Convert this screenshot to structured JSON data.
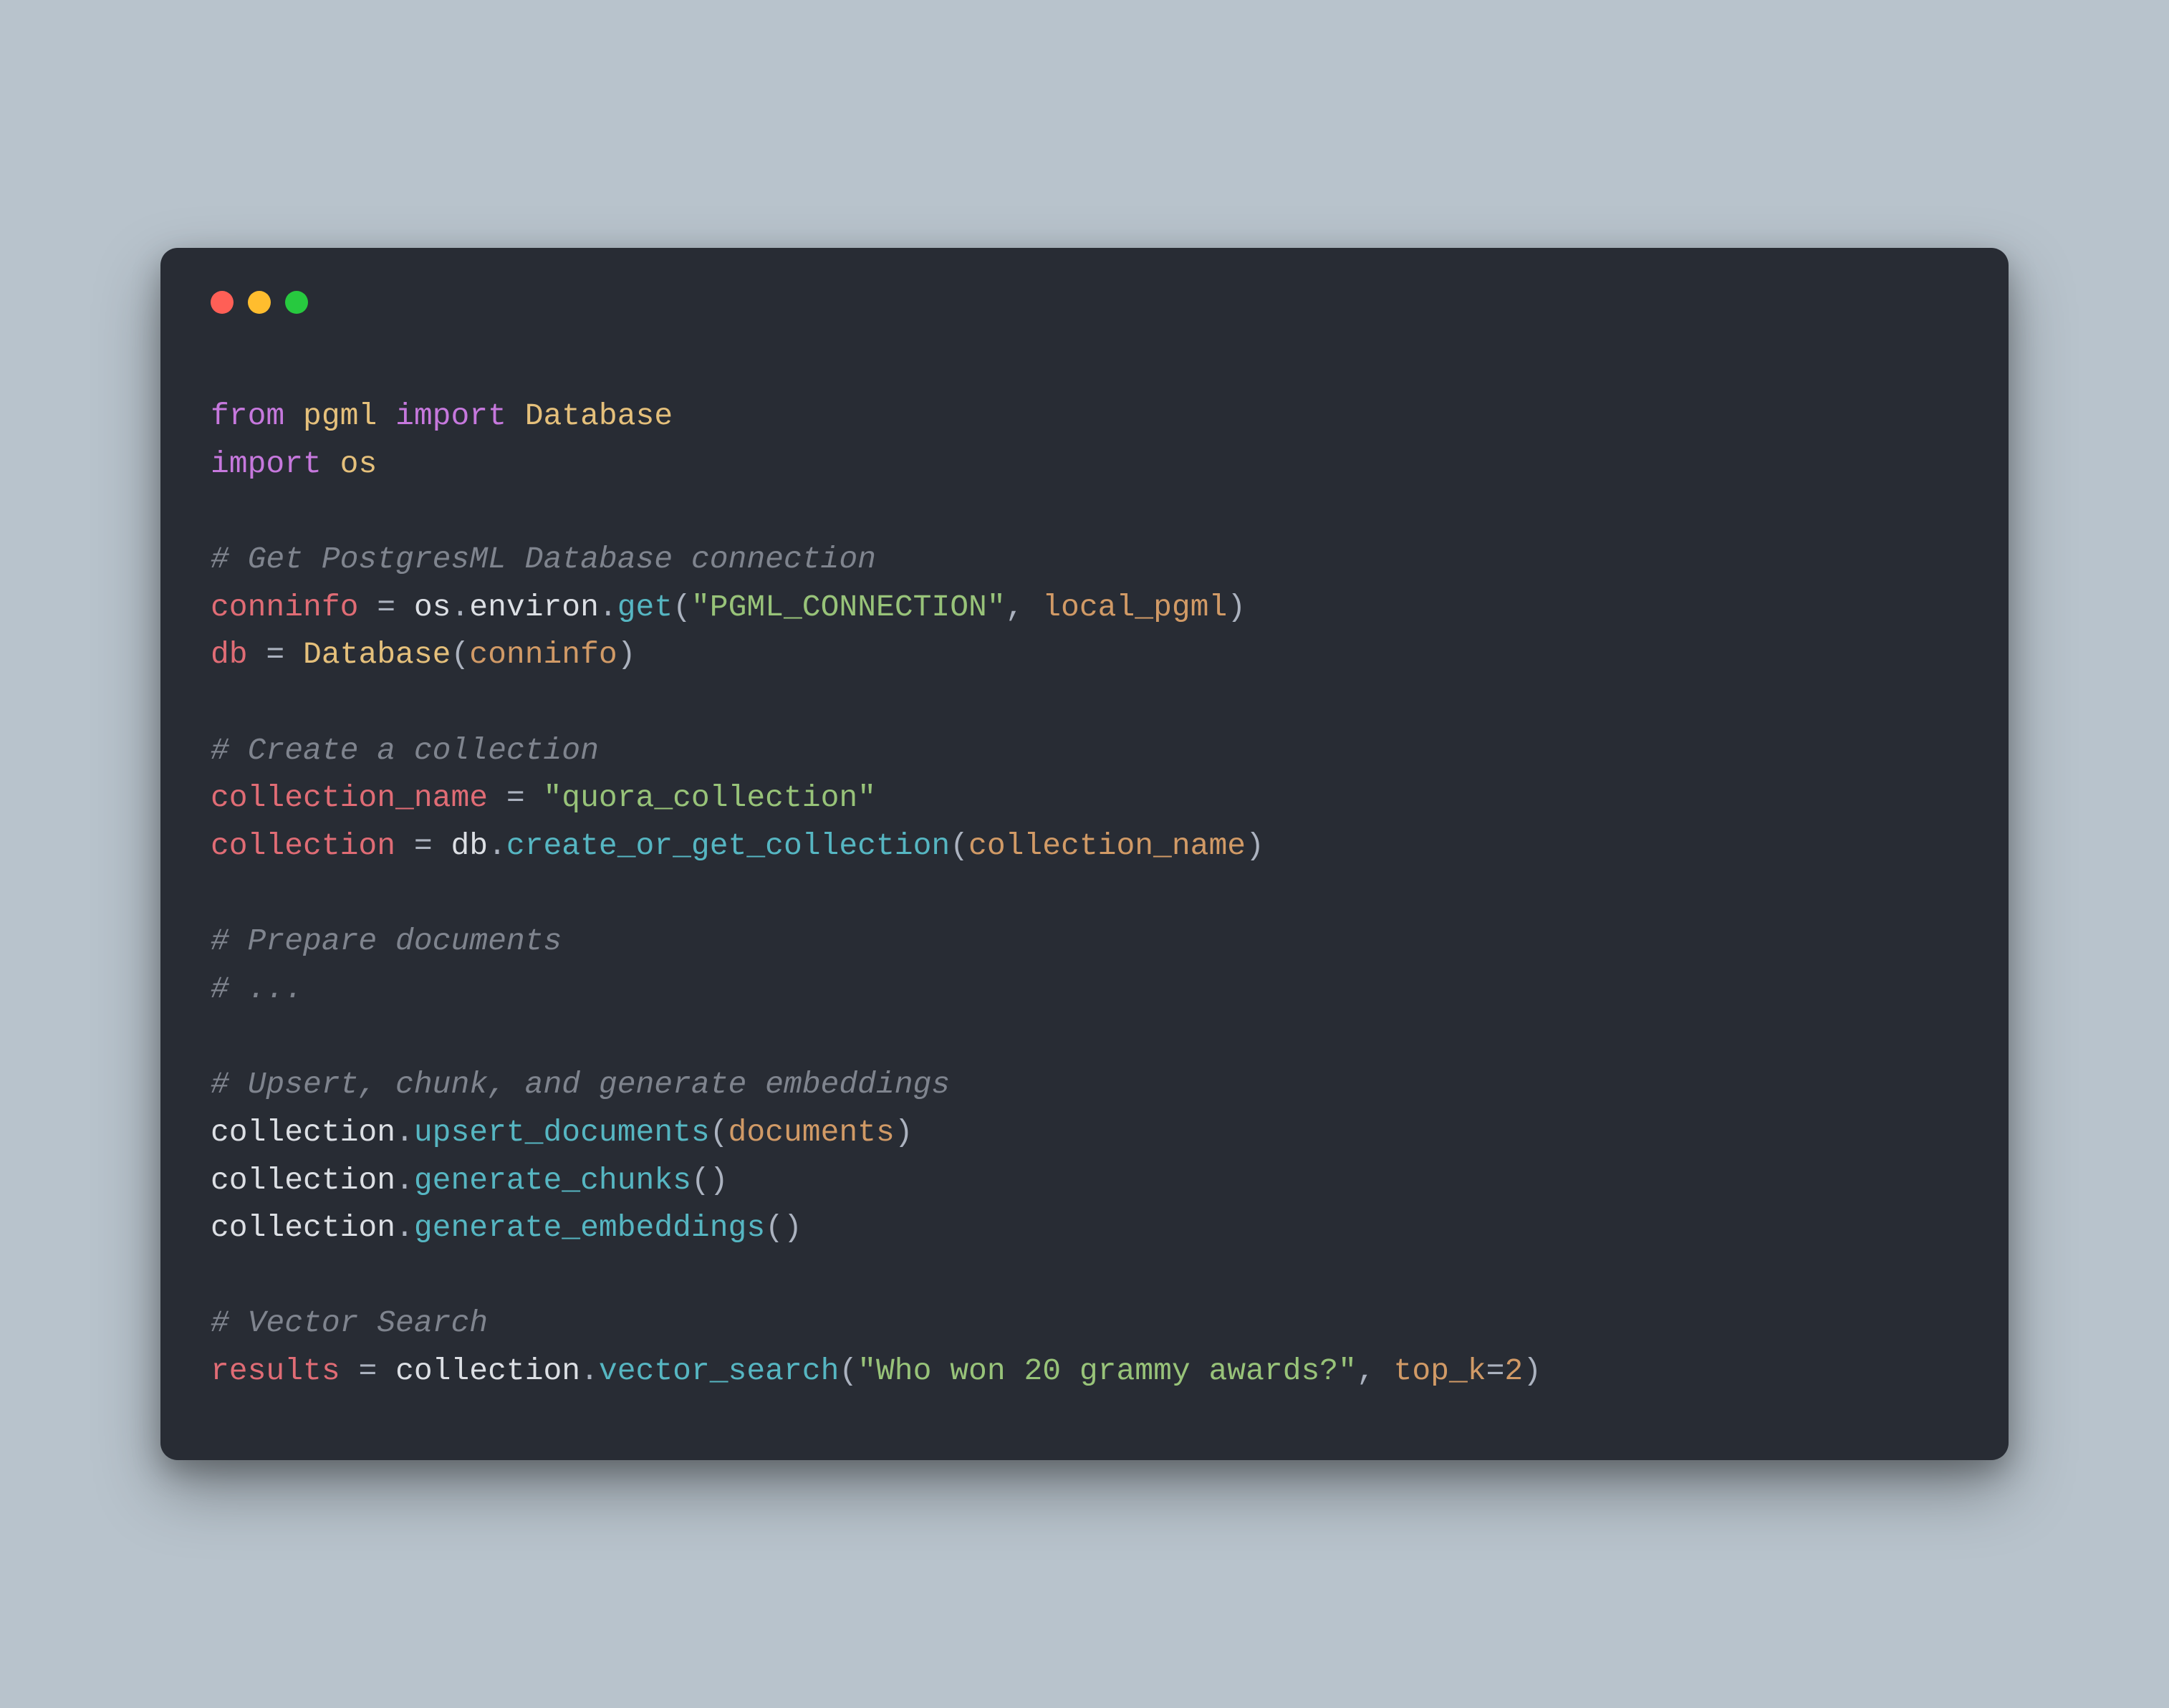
{
  "window": {
    "traffic_lights": {
      "red": "#ff5f56",
      "yellow": "#ffbd2e",
      "green": "#27c93f"
    }
  },
  "code": {
    "line1": {
      "from": "from",
      "mod1": "pgml",
      "import": "import",
      "cls": "Database"
    },
    "line2": {
      "import": "import",
      "mod": "os"
    },
    "line3": {
      "comment": "# Get PostgresML Database connection"
    },
    "line4": {
      "lhs": "conninfo",
      "eq": " = ",
      "obj": "os",
      "dot1": ".",
      "attr": "environ",
      "dot2": ".",
      "method": "get",
      "lp": "(",
      "str": "\"PGML_CONNECTION\"",
      "comma": ", ",
      "arg": "local_pgml",
      "rp": ")"
    },
    "line5": {
      "lhs": "db",
      "eq": " = ",
      "cls": "Database",
      "lp": "(",
      "arg": "conninfo",
      "rp": ")"
    },
    "line6": {
      "comment": "# Create a collection"
    },
    "line7": {
      "lhs": "collection_name",
      "eq": " = ",
      "str": "\"quora_collection\""
    },
    "line8": {
      "lhs": "collection",
      "eq": " = ",
      "obj": "db",
      "dot": ".",
      "method": "create_or_get_collection",
      "lp": "(",
      "arg": "collection_name",
      "rp": ")"
    },
    "line9": {
      "comment": "# Prepare documents"
    },
    "line10": {
      "comment": "# ..."
    },
    "line11": {
      "comment": "# Upsert, chunk, and generate embeddings"
    },
    "line12": {
      "obj": "collection",
      "dot": ".",
      "method": "upsert_documents",
      "lp": "(",
      "arg": "documents",
      "rp": ")"
    },
    "line13": {
      "obj": "collection",
      "dot": ".",
      "method": "generate_chunks",
      "lp": "(",
      "rp": ")"
    },
    "line14": {
      "obj": "collection",
      "dot": ".",
      "method": "generate_embeddings",
      "lp": "(",
      "rp": ")"
    },
    "line15": {
      "comment": "# Vector Search"
    },
    "line16": {
      "lhs": "results",
      "eq": " = ",
      "obj": "collection",
      "dot": ".",
      "method": "vector_search",
      "lp": "(",
      "str": "\"Who won 20 grammy awards?\"",
      "comma": ", ",
      "kw": "top_k",
      "eq2": "=",
      "num": "2",
      "rp": ")"
    }
  }
}
